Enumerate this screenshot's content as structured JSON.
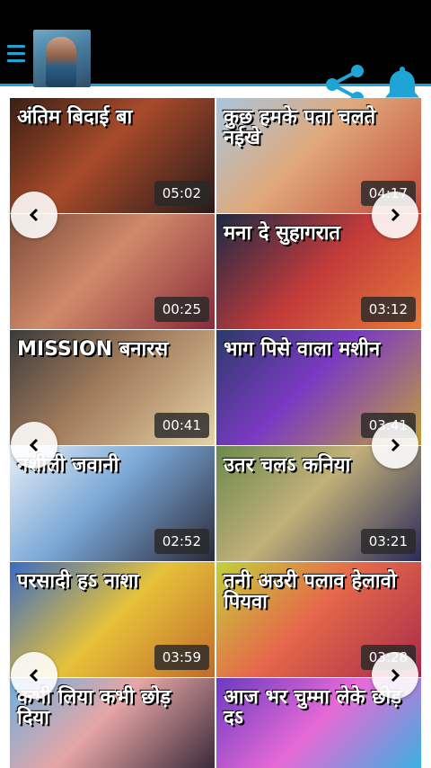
{
  "header": {
    "menu_icon": "hamburger-menu-icon",
    "share_icon": "share-icon",
    "notification_icon": "bell-icon",
    "accent_color": "#1fa4d6"
  },
  "videos": [
    {
      "title": "अंतिम बिदाई बा",
      "duration": "05:02",
      "bg": "linear-gradient(135deg,#3a1f14 0%,#a84b2a 45%,#2a1a1a 100%)"
    },
    {
      "title": "कुछ हमके पता चलते नईखे",
      "duration": "04:17",
      "bg": "linear-gradient(135deg,#a8c6de 0%,#e0a87a 45%,#c24a3a 100%)"
    },
    {
      "title": "",
      "duration": "00:25",
      "bg": "linear-gradient(135deg,#7a4a38 0%,#d08a6a 45%,#8a2a3a 100%)"
    },
    {
      "title": "मना दे सुहागरात",
      "duration": "03:12",
      "bg": "linear-gradient(135deg,#1a2a44 0%,#c23a3a 50%,#e87a3a 100%)"
    },
    {
      "title": "MISSION बनारस",
      "duration": "00:41",
      "bg": "linear-gradient(135deg,#3a3a3a 0%,#a07a5a 45%,#e6d2a6 100%)"
    },
    {
      "title": "भाग पिसे वाला मशीन",
      "duration": "03:41",
      "bg": "linear-gradient(135deg,#2a3a6a 0%,#7a3ac2 45%,#c2a03a 100%)"
    },
    {
      "title": "नशीली जवानी",
      "duration": "02:52",
      "bg": "linear-gradient(135deg,#e6eef6 0%,#7aa8d6 45%,#2a2a3a 100%)"
    },
    {
      "title": "उतर चलऽ कनिया",
      "duration": "03:21",
      "bg": "linear-gradient(135deg,#6a8a4a 0%,#c2b07a 45%,#2a2a5a 100%)"
    },
    {
      "title": "परसादी हऽ नाशा",
      "duration": "03:59",
      "bg": "linear-gradient(135deg,#3a6ac2 0%,#e6c23a 50%,#c26a2a 100%)"
    },
    {
      "title": "तनी अउरी पलाव हेलावो पियवा",
      "duration": "03:28",
      "bg": "linear-gradient(135deg,#c2d23a 0%,#e66a4a 45%,#a82a4a 100%)"
    },
    {
      "title": "कभी लिया कभी छोड़ दिया",
      "duration": "",
      "bg": "linear-gradient(135deg,#6ab0e0 0%,#e6a6a6 45%,#3a2a3a 100%)"
    },
    {
      "title": "आज भर चुम्मा लेके छोड़ दऽ",
      "duration": "",
      "bg": "linear-gradient(135deg,#6a3ac2 0%,#e66ad6 50%,#3ab0e0 100%)"
    }
  ]
}
